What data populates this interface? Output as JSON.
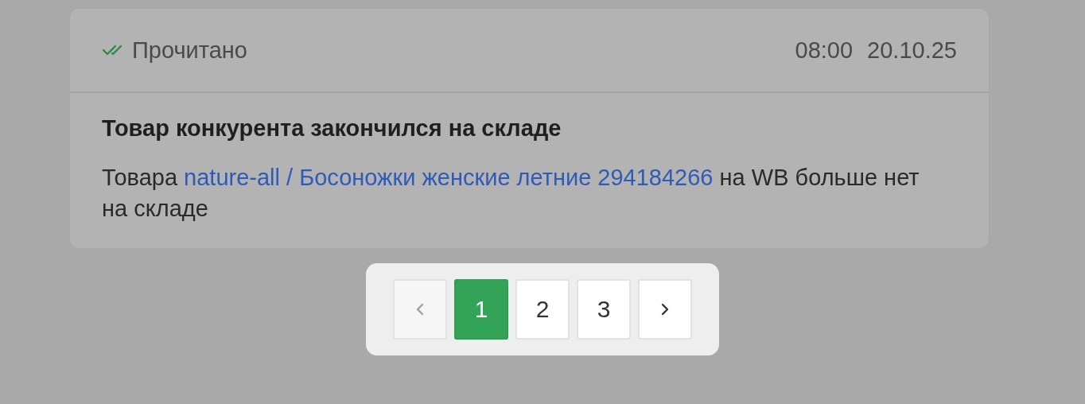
{
  "notification": {
    "status": {
      "label": "Прочитано",
      "read": true
    },
    "time": "08:00",
    "date": "20.10.25",
    "title": "Товар конкурента закончился на складе",
    "message": {
      "before": "Товара",
      "link": "nature-all / Босоножки женские летние 294184266",
      "after": "на WB больше нет на складе"
    }
  },
  "pagination": {
    "prev": {
      "disabled": true
    },
    "pages": [
      {
        "label": "1",
        "selected": true
      },
      {
        "label": "2",
        "selected": false
      },
      {
        "label": "3",
        "selected": false
      }
    ],
    "next": {
      "disabled": false
    }
  }
}
